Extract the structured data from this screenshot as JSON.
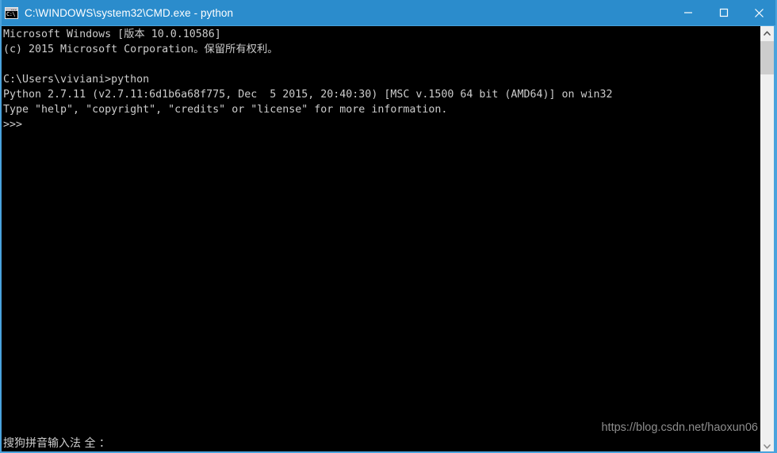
{
  "window": {
    "title": "C:\\WINDOWS\\system32\\CMD.exe - python",
    "icon_label": "C:\\",
    "titlebar_color": "#2b8ccc",
    "border_color": "#4aa3dd",
    "controls": {
      "minimize_label": "Minimize",
      "maximize_label": "Maximize",
      "close_label": "Close"
    }
  },
  "console": {
    "background_color": "#000000",
    "text_color": "#cccccc",
    "lines": [
      "Microsoft Windows [版本 10.0.10586]",
      "(c) 2015 Microsoft Corporation。保留所有权利。",
      "",
      "C:\\Users\\viviani>python",
      "Python 2.7.11 (v2.7.11:6d1b6a68f775, Dec  5 2015, 20:40:30) [MSC v.1500 64 bit (AMD64)] on win32",
      "Type \"help\", \"copyright\", \"credits\" or \"license\" for more information.",
      ">>>"
    ],
    "text": "Microsoft Windows [版本 10.0.10586]\n(c) 2015 Microsoft Corporation。保留所有权利。\n\nC:\\Users\\viviani>python\nPython 2.7.11 (v2.7.11:6d1b6a68f775, Dec  5 2015, 20:40:30) [MSC v.1500 64 bit (AMD64)] on win32\nType \"help\", \"copyright\", \"credits\" or \"license\" for more information.\n>>>",
    "ime_status": "搜狗拼音输入法 全 ："
  },
  "watermark": {
    "text": "https://blog.csdn.net/haoxun06"
  },
  "scrollbar": {
    "up_arrow": "▲",
    "down_arrow": "▼",
    "track_color": "#f0f0f0",
    "thumb_color": "#cdcdcd"
  }
}
